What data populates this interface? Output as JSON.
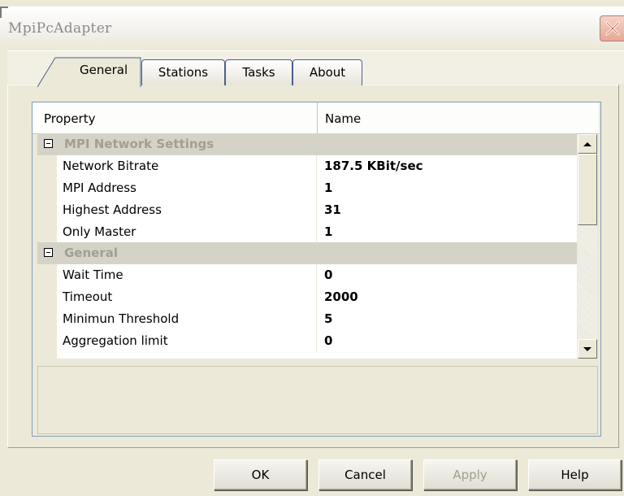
{
  "window": {
    "title": "MpiPcAdapter"
  },
  "tabs": [
    {
      "label": "General",
      "selected": true
    },
    {
      "label": "Stations",
      "selected": false
    },
    {
      "label": "Tasks",
      "selected": false
    },
    {
      "label": "About",
      "selected": false
    }
  ],
  "grid": {
    "header": {
      "property": "Property",
      "name": "Name"
    },
    "categories": {
      "mpi": {
        "label": "MPI Network Settings"
      },
      "general": {
        "label": "General"
      }
    },
    "rows": [
      {
        "property": "Network Bitrate",
        "value": "187.5 KBit/sec"
      },
      {
        "property": "MPI Address",
        "value": "1"
      },
      {
        "property": "Highest Address",
        "value": "31"
      },
      {
        "property": "Only Master",
        "value": "1"
      },
      {
        "property": "Wait Time",
        "value": "0"
      },
      {
        "property": "Timeout",
        "value": "2000"
      },
      {
        "property": "Minimun Threshold",
        "value": "5"
      },
      {
        "property": "Aggregation limit",
        "value": "0"
      }
    ]
  },
  "buttons": {
    "ok": "OK",
    "cancel": "Cancel",
    "apply": "Apply",
    "help": "Help"
  },
  "colors": {
    "dialog_bg": "#ece9d8",
    "category_bg": "#d5d3c7",
    "disabled_text": "#a19f92"
  }
}
